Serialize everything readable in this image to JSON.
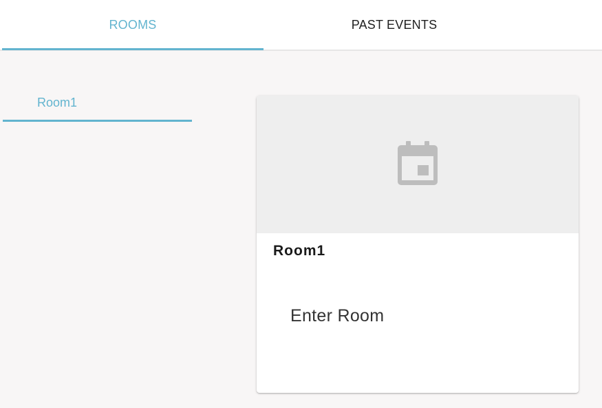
{
  "tabs": [
    {
      "label": "ROOMS",
      "active": true
    },
    {
      "label": "PAST EVENTS",
      "active": false
    }
  ],
  "sidebar": {
    "items": [
      {
        "label": "Room1",
        "selected": true
      }
    ]
  },
  "card": {
    "icon": "calendar-icon",
    "title": "Room1",
    "action_label": "Enter Room"
  },
  "colors": {
    "accent": "#62b4cf",
    "background": "#f8f6f6",
    "card_media": "#eeeeee",
    "icon": "#bdbdbd"
  }
}
